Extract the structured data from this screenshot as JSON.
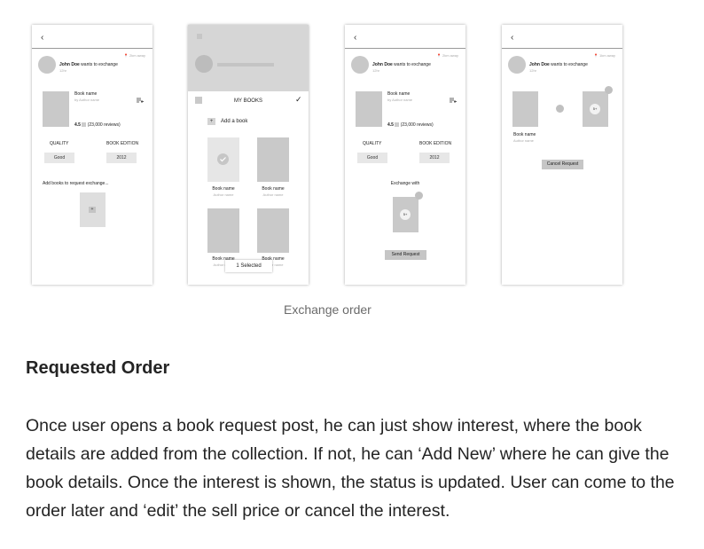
{
  "screens": {
    "s1": {
      "back_icon": "‹",
      "distance": "📍 2km away",
      "user_line": {
        "name": "John Doe",
        "rest": "wants to exchange"
      },
      "time": "12hr",
      "book_name": "Book name",
      "author": "by Author name",
      "rating": "4.5",
      "reviews": "(23,000 reviews)",
      "quality_label": "QUALITY",
      "edition_label": "BOOK EDITION",
      "quality_value": "Good",
      "edition_value": "2012",
      "add_books_text": "Add books to request exchange...",
      "add_icon": "+"
    },
    "s2": {
      "my_books": "MY BOOKS",
      "add_a_book": "Add a book",
      "add_icon": "+",
      "check_icon": "✓",
      "book_name": "Book name",
      "author_name": "Author name",
      "selected": "1 Selected"
    },
    "s3": {
      "back_icon": "‹",
      "distance": "📍 2km away",
      "user_line": {
        "name": "John Doe",
        "rest": "wants to exchange"
      },
      "time": "12hr",
      "book_name": "Book name",
      "author": "by Author name",
      "rating": "4.5",
      "reviews": "(23,000 reviews)",
      "quality_label": "QUALITY",
      "edition_label": "BOOK EDITION",
      "quality_value": "Good",
      "edition_value": "2012",
      "exchange_with": "Exchange with",
      "badge": "5+",
      "send_request": "Send Request"
    },
    "s4": {
      "back_icon": "‹",
      "distance": "📍 1km away",
      "user_line": {
        "name": "John Doe",
        "rest": "wants to exchange"
      },
      "time": "12hr",
      "book_name": "Book name",
      "author_name": "Author name",
      "badge": "5+",
      "cancel_request": "Cancel Request"
    }
  },
  "caption": "Exchange order",
  "section_heading": "Requested Order",
  "paragraph": "Once user opens a book request post, he can just show interest, where the book details are added from the collection. If not, he can ‘Add New’ where he can give the book details. Once the interest is shown, the status is updated. User can come to the order later and ‘edit’ the sell price or cancel the interest.",
  "colors": {
    "text": "#242424",
    "caption": "#6b6b6b",
    "placeholder": "#c9c9c9"
  }
}
